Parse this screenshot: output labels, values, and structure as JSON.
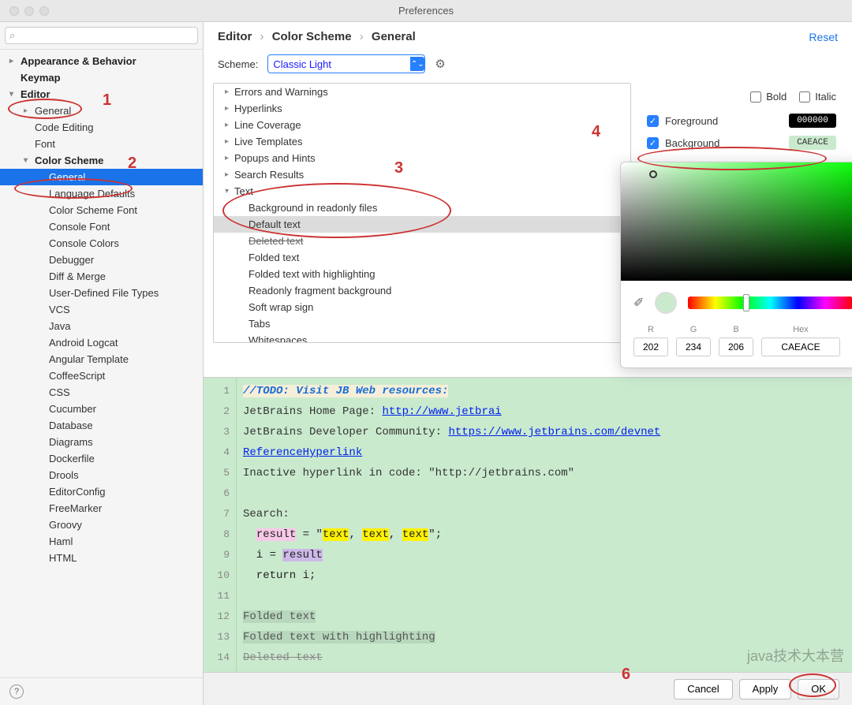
{
  "window": {
    "title": "Preferences"
  },
  "search": {
    "placeholder": ""
  },
  "sidebar": {
    "items": [
      {
        "label": "Appearance & Behavior",
        "lvl": 0,
        "arrow": "▸",
        "bold": true
      },
      {
        "label": "Keymap",
        "lvl": 0,
        "arrow": "",
        "bold": true
      },
      {
        "label": "Editor",
        "lvl": 0,
        "arrow": "▾",
        "bold": true,
        "editor": true
      },
      {
        "label": "General",
        "lvl": 1,
        "arrow": "▸"
      },
      {
        "label": "Code Editing",
        "lvl": 1,
        "arrow": ""
      },
      {
        "label": "Font",
        "lvl": 1,
        "arrow": ""
      },
      {
        "label": "Color Scheme",
        "lvl": 1,
        "arrow": "▾",
        "bold": true
      },
      {
        "label": "General",
        "lvl": 2,
        "arrow": "",
        "selected": true
      },
      {
        "label": "Language Defaults",
        "lvl": 2,
        "arrow": ""
      },
      {
        "label": "Color Scheme Font",
        "lvl": 2,
        "arrow": ""
      },
      {
        "label": "Console Font",
        "lvl": 2,
        "arrow": ""
      },
      {
        "label": "Console Colors",
        "lvl": 2,
        "arrow": ""
      },
      {
        "label": "Debugger",
        "lvl": 2,
        "arrow": ""
      },
      {
        "label": "Diff & Merge",
        "lvl": 2,
        "arrow": ""
      },
      {
        "label": "User-Defined File Types",
        "lvl": 2,
        "arrow": ""
      },
      {
        "label": "VCS",
        "lvl": 2,
        "arrow": ""
      },
      {
        "label": "Java",
        "lvl": 2,
        "arrow": ""
      },
      {
        "label": "Android Logcat",
        "lvl": 2,
        "arrow": ""
      },
      {
        "label": "Angular Template",
        "lvl": 2,
        "arrow": ""
      },
      {
        "label": "CoffeeScript",
        "lvl": 2,
        "arrow": ""
      },
      {
        "label": "CSS",
        "lvl": 2,
        "arrow": ""
      },
      {
        "label": "Cucumber",
        "lvl": 2,
        "arrow": ""
      },
      {
        "label": "Database",
        "lvl": 2,
        "arrow": ""
      },
      {
        "label": "Diagrams",
        "lvl": 2,
        "arrow": ""
      },
      {
        "label": "Dockerfile",
        "lvl": 2,
        "arrow": ""
      },
      {
        "label": "Drools",
        "lvl": 2,
        "arrow": ""
      },
      {
        "label": "EditorConfig",
        "lvl": 2,
        "arrow": ""
      },
      {
        "label": "FreeMarker",
        "lvl": 2,
        "arrow": ""
      },
      {
        "label": "Groovy",
        "lvl": 2,
        "arrow": ""
      },
      {
        "label": "Haml",
        "lvl": 2,
        "arrow": ""
      },
      {
        "label": "HTML",
        "lvl": 2,
        "arrow": ""
      }
    ]
  },
  "breadcrumb": {
    "p1": "Editor",
    "p2": "Color Scheme",
    "p3": "General"
  },
  "reset": "Reset",
  "scheme": {
    "label": "Scheme:",
    "value": "Classic Light"
  },
  "categories": [
    {
      "label": "Errors and Warnings",
      "lvl": 0,
      "arrow": "▸"
    },
    {
      "label": "Hyperlinks",
      "lvl": 0,
      "arrow": "▸"
    },
    {
      "label": "Line Coverage",
      "lvl": 0,
      "arrow": "▸"
    },
    {
      "label": "Live Templates",
      "lvl": 0,
      "arrow": "▸"
    },
    {
      "label": "Popups and Hints",
      "lvl": 0,
      "arrow": "▸"
    },
    {
      "label": "Search Results",
      "lvl": 0,
      "arrow": "▸"
    },
    {
      "label": "Text",
      "lvl": 0,
      "arrow": "▾"
    },
    {
      "label": "Background in readonly files",
      "lvl": 1,
      "arrow": ""
    },
    {
      "label": "Default text",
      "lvl": 1,
      "arrow": "",
      "selected": true
    },
    {
      "label": "Deleted text",
      "lvl": 1,
      "arrow": "",
      "strike": true
    },
    {
      "label": "Folded text",
      "lvl": 1,
      "arrow": ""
    },
    {
      "label": "Folded text with highlighting",
      "lvl": 1,
      "arrow": ""
    },
    {
      "label": "Readonly fragment background",
      "lvl": 1,
      "arrow": ""
    },
    {
      "label": "Soft wrap sign",
      "lvl": 1,
      "arrow": ""
    },
    {
      "label": "Tabs",
      "lvl": 1,
      "arrow": ""
    },
    {
      "label": "Whitespaces",
      "lvl": 1,
      "arrow": ""
    }
  ],
  "style": {
    "bold": "Bold",
    "italic": "Italic",
    "foreground": "Foreground",
    "background": "Background",
    "fg_val": "000000",
    "bg_val": "CAEACE"
  },
  "picker": {
    "r_lbl": "R",
    "g_lbl": "G",
    "b_lbl": "B",
    "hex_lbl": "Hex",
    "r": "202",
    "g": "234",
    "b": "206",
    "hex": "CAEACE"
  },
  "annotations": {
    "n1": "1",
    "n2": "2",
    "n3": "3",
    "n4": "4",
    "n6": "6"
  },
  "preview": {
    "gutter": [
      "1",
      "2",
      "3",
      "4",
      "5",
      "6",
      "7",
      "8",
      "9",
      "10",
      "11",
      "12",
      "13",
      "14"
    ],
    "l1_todo": "//TODO: Visit JB Web resources:",
    "l2_a": "JetBrains Home Page: ",
    "l2_b": "http://www.jetbrai",
    "l3_a": "JetBrains Developer Community: ",
    "l3_b": "https://www.jetbrains.com/devnet",
    "l4": "ReferenceHyperlink",
    "l5": "Inactive hyperlink in code: \"http://jetbrains.com\"",
    "l7": "Search:",
    "l8_a": "  ",
    "l8_b": "result",
    "l8_c": " = \"",
    "l8_d": "text",
    "l8_e": ", ",
    "l8_f": "text",
    "l8_g": ", ",
    "l8_h": "text",
    "l8_i": "\";",
    "l9_a": "  i = ",
    "l9_b": "result",
    "l10": "  return i;",
    "l12": "Folded text",
    "l13": "Folded text with highlighting",
    "l14": "Deleted text"
  },
  "footer": {
    "cancel": "Cancel",
    "apply": "Apply",
    "ok": "OK"
  },
  "watermark": "java技术大本营"
}
